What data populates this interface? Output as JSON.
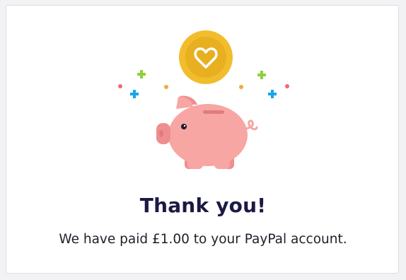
{
  "confirmation": {
    "title": "Thank you!",
    "message": "We have paid £1.00 to your PayPal account."
  },
  "illustration": {
    "coin_icon": "heart-coin-icon",
    "piggy_icon": "piggy-bank-icon",
    "colors": {
      "coin": "#f2bd2c",
      "coin_inner": "#e8b020",
      "pig": "#f7a6a4",
      "pig_dark": "#ee8e8f",
      "plus_green": "#8dd13a",
      "plus_blue": "#1aa6e8",
      "dot_orange": "#f2a93b",
      "dot_red": "#ef6b73"
    }
  }
}
